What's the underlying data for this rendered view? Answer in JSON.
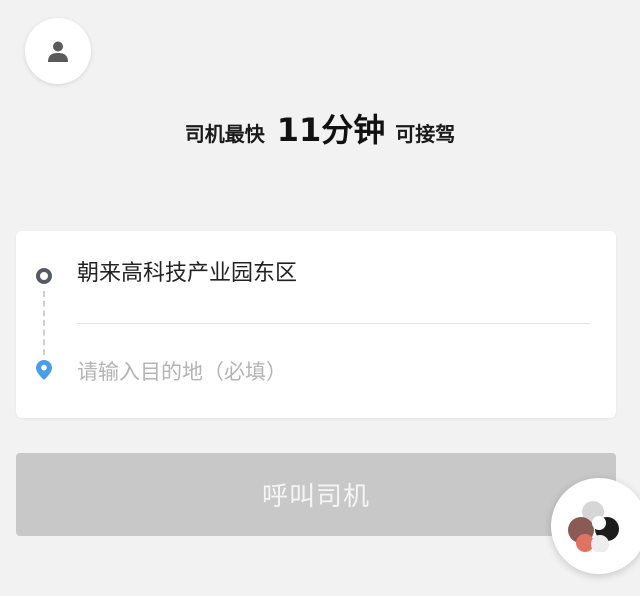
{
  "header": {
    "avatar_icon": "user-icon"
  },
  "eta": {
    "prefix": "司机最快",
    "time": "11分钟",
    "suffix": "可接驾"
  },
  "route": {
    "origin_icon": "origin-dot-icon",
    "origin": "朝来高科技产业园东区",
    "destination_icon": "location-pin-icon",
    "destination_value": "",
    "destination_placeholder": "请输入目的地（必填）"
  },
  "actions": {
    "call_label": "呼叫司机"
  },
  "colors": {
    "background": "#f2f2f2",
    "card": "#ffffff",
    "button_disabled": "#c8c8c8",
    "pin_blue": "#4a9ee8",
    "origin_gray": "#555b66"
  },
  "floating_widget": {
    "icon": "assistant-bubble-icon"
  }
}
